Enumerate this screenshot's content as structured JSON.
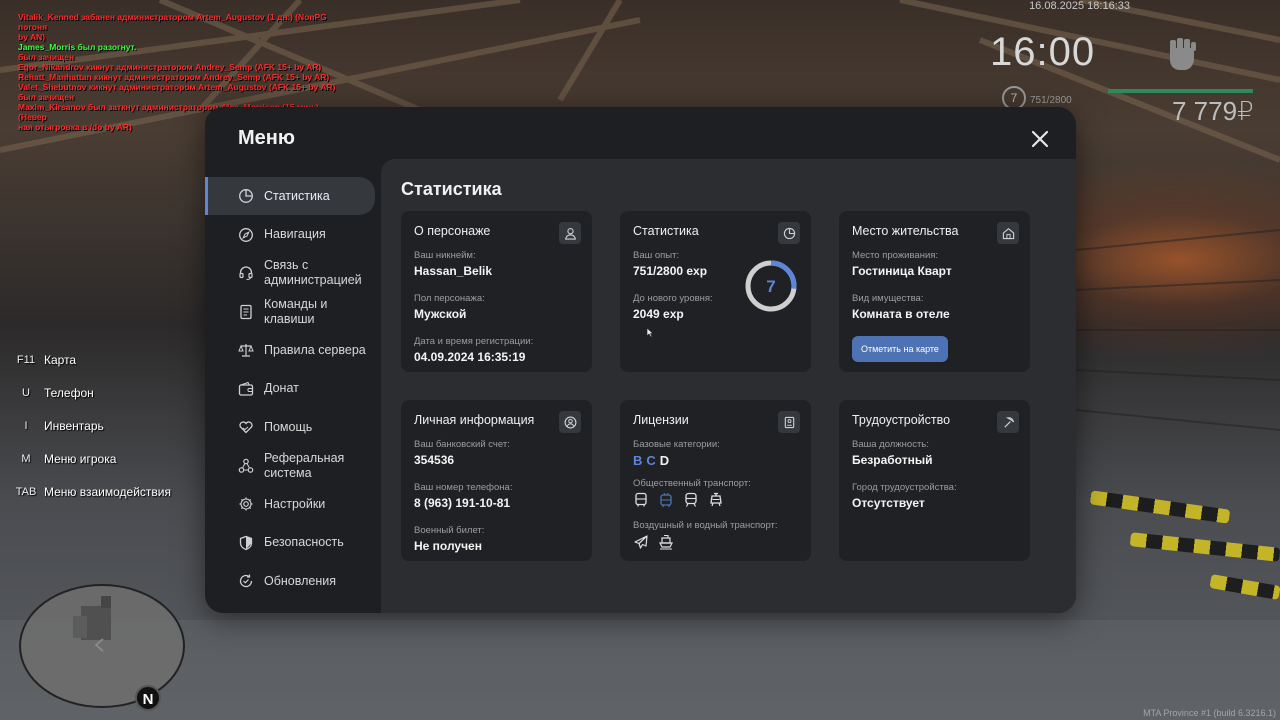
{
  "chat": [
    {
      "text": "Vitalik_Kenned забанен администратором Artem_Augustov (1 дн.) (NonPG погоня",
      "color": "red"
    },
    {
      "text": "  by AN)",
      "color": "red"
    },
    {
      "text": "James_Morris был разогнут.",
      "color": "green"
    },
    {
      "text": "  был зачищен",
      "color": "red"
    },
    {
      "text": "Egor_Nikandrov кикнут администратором Andrey_Semp (AFK 15+ by AR)",
      "color": "red"
    },
    {
      "text": "Rehatt_Manhattan кикнут администратором Andrey_Semp (AFK 15+ by AR)",
      "color": "red"
    },
    {
      "text": "Valet_Shebutnov кикнут администратором Artem_Augustov (AFK 15+ by AR)",
      "color": "red"
    },
    {
      "text": "  был зачищен",
      "color": "red"
    },
    {
      "text": "Maxim_Kirsanov был заткнут администратором Alex_Morrison (15 мин.) (Невер",
      "color": "red"
    },
    {
      "text": "  ная отыгровка в /do by AR)",
      "color": "red"
    }
  ],
  "hud": {
    "datetime": "16.08.2025 18:16:33",
    "time": "16:00",
    "level": "7",
    "exp": "751/2800",
    "money": "7 779₽"
  },
  "hints": [
    {
      "key": "F11",
      "label": "Карта"
    },
    {
      "key": "U",
      "label": "Телефон"
    },
    {
      "key": "I",
      "label": "Инвентарь"
    },
    {
      "key": "M",
      "label": "Меню игрока"
    },
    {
      "key": "TAB",
      "label": "Меню взаимодействия"
    }
  ],
  "minimap": {
    "compass": "N"
  },
  "watermark": "MTA Province #1 (build 6.3216.1)",
  "menu": {
    "title": "Меню",
    "nav": [
      {
        "label": "Статистика",
        "icon": "pie-chart-icon"
      },
      {
        "label": "Навигация",
        "icon": "compass-icon"
      },
      {
        "label": "Связь с администрацией",
        "icon": "headset-icon"
      },
      {
        "label": "Команды и клавиши",
        "icon": "document-icon"
      },
      {
        "label": "Правила сервера",
        "icon": "scales-icon"
      },
      {
        "label": "Донат",
        "icon": "wallet-icon"
      },
      {
        "label": "Помощь",
        "icon": "heart-hand-icon"
      },
      {
        "label": "Реферальная система",
        "icon": "network-icon"
      },
      {
        "label": "Настройки",
        "icon": "gear-icon"
      },
      {
        "label": "Безопасность",
        "icon": "shield-icon"
      },
      {
        "label": "Обновления",
        "icon": "refresh-check-icon"
      }
    ],
    "accent": "#5d86d8"
  },
  "stats": {
    "title": "Статистика",
    "character": {
      "title": "О персонаже",
      "nickname_label": "Ваш никнейм:",
      "nickname": "Hassan_Belik",
      "gender_label": "Пол персонажа:",
      "gender": "Мужской",
      "reg_label": "Дата и время регистрации:",
      "reg": "04.09.2024 16:35:19"
    },
    "statistics": {
      "title": "Статистика",
      "exp_label": "Ваш опыт:",
      "exp": "751/2800 exp",
      "next_label": "До нового уровня:",
      "next": "2049 exp",
      "level": "7",
      "progress": 0.268
    },
    "residence": {
      "title": "Место жительства",
      "place_label": "Место проживания:",
      "place": "Гостиница Кварт",
      "prop_label": "Вид имущества:",
      "prop": "Комната в отеле",
      "button": "Отметить на карте"
    },
    "personal": {
      "title": "Личная информация",
      "bank_label": "Ваш банковский счет:",
      "bank": "354536",
      "phone_label": "Ваш номер телефона:",
      "phone": "8 (963) 191-10-81",
      "military_label": "Военный билет:",
      "military": "Не получен"
    },
    "licenses": {
      "title": "Лицензии",
      "base_label": "Базовые категории:",
      "categories": [
        "B",
        "C",
        "D"
      ],
      "public_label": "Общественный транспорт:",
      "air_label": "Воздушный и водный транспорт:"
    },
    "employment": {
      "title": "Трудоустройство",
      "position_label": "Ваша должность:",
      "position": "Безработный",
      "city_label": "Город трудоустройства:",
      "city": "Отсутствует"
    }
  }
}
